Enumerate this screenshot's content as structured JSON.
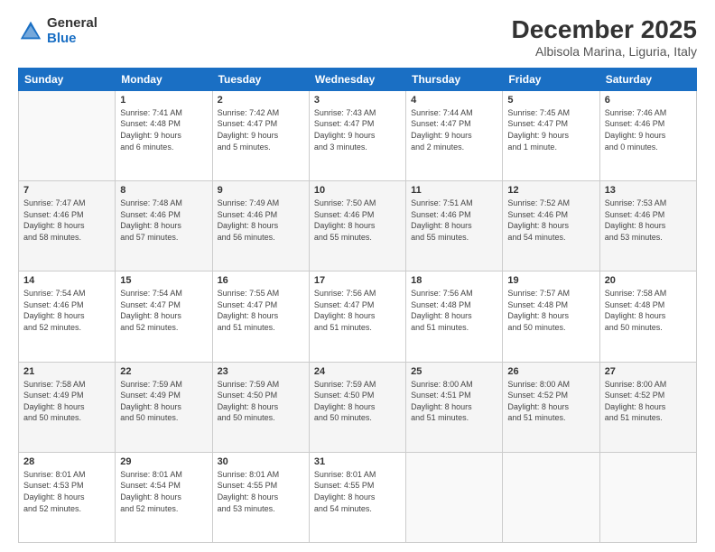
{
  "logo": {
    "general": "General",
    "blue": "Blue"
  },
  "header": {
    "month": "December 2025",
    "location": "Albisola Marina, Liguria, Italy"
  },
  "weekdays": [
    "Sunday",
    "Monday",
    "Tuesday",
    "Wednesday",
    "Thursday",
    "Friday",
    "Saturday"
  ],
  "weeks": [
    [
      {
        "day": "",
        "info": ""
      },
      {
        "day": "1",
        "info": "Sunrise: 7:41 AM\nSunset: 4:48 PM\nDaylight: 9 hours\nand 6 minutes."
      },
      {
        "day": "2",
        "info": "Sunrise: 7:42 AM\nSunset: 4:47 PM\nDaylight: 9 hours\nand 5 minutes."
      },
      {
        "day": "3",
        "info": "Sunrise: 7:43 AM\nSunset: 4:47 PM\nDaylight: 9 hours\nand 3 minutes."
      },
      {
        "day": "4",
        "info": "Sunrise: 7:44 AM\nSunset: 4:47 PM\nDaylight: 9 hours\nand 2 minutes."
      },
      {
        "day": "5",
        "info": "Sunrise: 7:45 AM\nSunset: 4:47 PM\nDaylight: 9 hours\nand 1 minute."
      },
      {
        "day": "6",
        "info": "Sunrise: 7:46 AM\nSunset: 4:46 PM\nDaylight: 9 hours\nand 0 minutes."
      }
    ],
    [
      {
        "day": "7",
        "info": "Sunrise: 7:47 AM\nSunset: 4:46 PM\nDaylight: 8 hours\nand 58 minutes."
      },
      {
        "day": "8",
        "info": "Sunrise: 7:48 AM\nSunset: 4:46 PM\nDaylight: 8 hours\nand 57 minutes."
      },
      {
        "day": "9",
        "info": "Sunrise: 7:49 AM\nSunset: 4:46 PM\nDaylight: 8 hours\nand 56 minutes."
      },
      {
        "day": "10",
        "info": "Sunrise: 7:50 AM\nSunset: 4:46 PM\nDaylight: 8 hours\nand 55 minutes."
      },
      {
        "day": "11",
        "info": "Sunrise: 7:51 AM\nSunset: 4:46 PM\nDaylight: 8 hours\nand 55 minutes."
      },
      {
        "day": "12",
        "info": "Sunrise: 7:52 AM\nSunset: 4:46 PM\nDaylight: 8 hours\nand 54 minutes."
      },
      {
        "day": "13",
        "info": "Sunrise: 7:53 AM\nSunset: 4:46 PM\nDaylight: 8 hours\nand 53 minutes."
      }
    ],
    [
      {
        "day": "14",
        "info": "Sunrise: 7:54 AM\nSunset: 4:46 PM\nDaylight: 8 hours\nand 52 minutes."
      },
      {
        "day": "15",
        "info": "Sunrise: 7:54 AM\nSunset: 4:47 PM\nDaylight: 8 hours\nand 52 minutes."
      },
      {
        "day": "16",
        "info": "Sunrise: 7:55 AM\nSunset: 4:47 PM\nDaylight: 8 hours\nand 51 minutes."
      },
      {
        "day": "17",
        "info": "Sunrise: 7:56 AM\nSunset: 4:47 PM\nDaylight: 8 hours\nand 51 minutes."
      },
      {
        "day": "18",
        "info": "Sunrise: 7:56 AM\nSunset: 4:48 PM\nDaylight: 8 hours\nand 51 minutes."
      },
      {
        "day": "19",
        "info": "Sunrise: 7:57 AM\nSunset: 4:48 PM\nDaylight: 8 hours\nand 50 minutes."
      },
      {
        "day": "20",
        "info": "Sunrise: 7:58 AM\nSunset: 4:48 PM\nDaylight: 8 hours\nand 50 minutes."
      }
    ],
    [
      {
        "day": "21",
        "info": "Sunrise: 7:58 AM\nSunset: 4:49 PM\nDaylight: 8 hours\nand 50 minutes."
      },
      {
        "day": "22",
        "info": "Sunrise: 7:59 AM\nSunset: 4:49 PM\nDaylight: 8 hours\nand 50 minutes."
      },
      {
        "day": "23",
        "info": "Sunrise: 7:59 AM\nSunset: 4:50 PM\nDaylight: 8 hours\nand 50 minutes."
      },
      {
        "day": "24",
        "info": "Sunrise: 7:59 AM\nSunset: 4:50 PM\nDaylight: 8 hours\nand 50 minutes."
      },
      {
        "day": "25",
        "info": "Sunrise: 8:00 AM\nSunset: 4:51 PM\nDaylight: 8 hours\nand 51 minutes."
      },
      {
        "day": "26",
        "info": "Sunrise: 8:00 AM\nSunset: 4:52 PM\nDaylight: 8 hours\nand 51 minutes."
      },
      {
        "day": "27",
        "info": "Sunrise: 8:00 AM\nSunset: 4:52 PM\nDaylight: 8 hours\nand 51 minutes."
      }
    ],
    [
      {
        "day": "28",
        "info": "Sunrise: 8:01 AM\nSunset: 4:53 PM\nDaylight: 8 hours\nand 52 minutes."
      },
      {
        "day": "29",
        "info": "Sunrise: 8:01 AM\nSunset: 4:54 PM\nDaylight: 8 hours\nand 52 minutes."
      },
      {
        "day": "30",
        "info": "Sunrise: 8:01 AM\nSunset: 4:55 PM\nDaylight: 8 hours\nand 53 minutes."
      },
      {
        "day": "31",
        "info": "Sunrise: 8:01 AM\nSunset: 4:55 PM\nDaylight: 8 hours\nand 54 minutes."
      },
      {
        "day": "",
        "info": ""
      },
      {
        "day": "",
        "info": ""
      },
      {
        "day": "",
        "info": ""
      }
    ]
  ]
}
